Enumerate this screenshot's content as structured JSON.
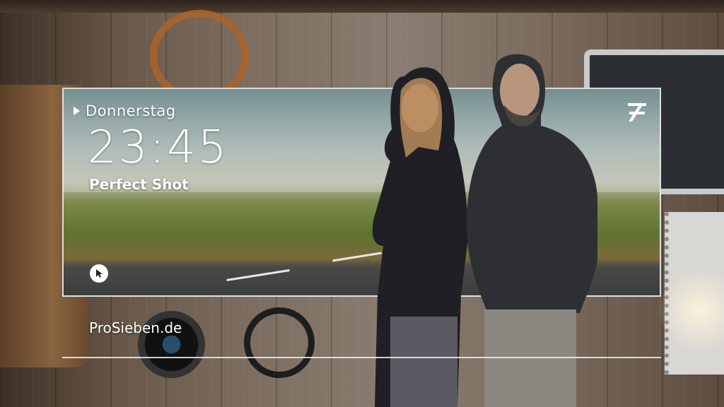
{
  "broadcast": {
    "day": "Donnerstag",
    "time": "23:45",
    "show_title": "Perfect Shot",
    "website": "ProSieben.de"
  },
  "icons": {
    "day_marker": "play-icon",
    "interactive": "cursor-icon",
    "channel_logo": "prosieben-logo"
  },
  "colors": {
    "text": "#ffffff",
    "frame": "#ebebeb"
  }
}
